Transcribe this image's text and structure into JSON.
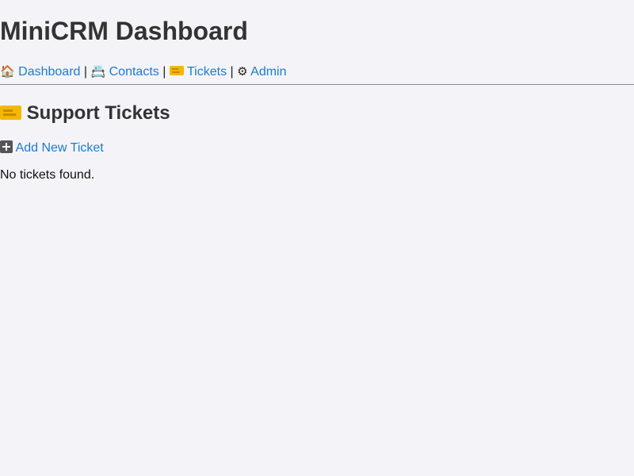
{
  "app": {
    "title": "MiniCRM Dashboard"
  },
  "nav": {
    "items": [
      {
        "icon": "house-icon",
        "glyph": "🏠",
        "label": "Dashboard"
      },
      {
        "icon": "fax-icon",
        "glyph": "📇",
        "label": "Contacts"
      },
      {
        "icon": "ticket-icon",
        "glyph": "🎫",
        "label": "Tickets"
      },
      {
        "icon": "gear-icon",
        "glyph": "⚙",
        "label": "Admin"
      }
    ],
    "separator": "|"
  },
  "section": {
    "icon": "ticket-icon",
    "title": "Support Tickets"
  },
  "actions": {
    "add_icon": "plus-icon",
    "add_label": "Add New Ticket"
  },
  "tickets": {
    "empty_message": "No tickets found."
  },
  "colors": {
    "link": "#1b7bd4",
    "heading": "#333333",
    "background": "#f4f4f8"
  }
}
